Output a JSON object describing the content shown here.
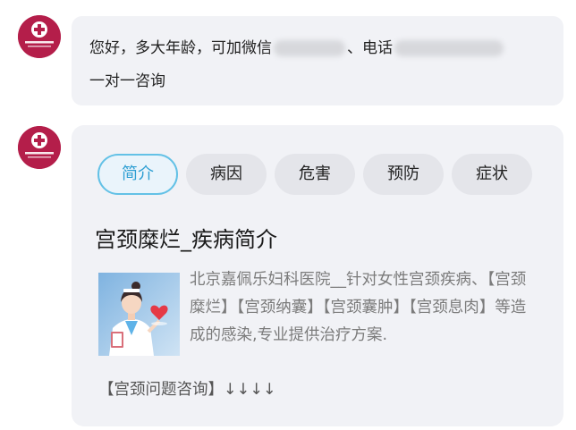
{
  "message1": {
    "text_before": "您好，多大年龄，可加微信",
    "wechat_redacted": "",
    "text_middle": "、电话",
    "phone_redacted": "",
    "line2": "一对一咨询"
  },
  "brand": {
    "color": "#b41e4a",
    "logo_text": "北京嘉佩乐妇科医院"
  },
  "card": {
    "tabs": [
      {
        "label": "简介",
        "active": true
      },
      {
        "label": "病因",
        "active": false
      },
      {
        "label": "危害",
        "active": false
      },
      {
        "label": "预防",
        "active": false
      },
      {
        "label": "症状",
        "active": false
      }
    ],
    "title": "宫颈糜烂_疾病简介",
    "description": "北京嘉佩乐妇科医院__针对女性宫颈疾病、【宫颈糜烂】【宫颈纳囊】【宫颈囊肿】【宫颈息肉】等造成的感染,专业提供治疗方案.",
    "link": "【宫颈问题咨询】↓↓↓↓",
    "accent_color": "#63c1e6"
  }
}
